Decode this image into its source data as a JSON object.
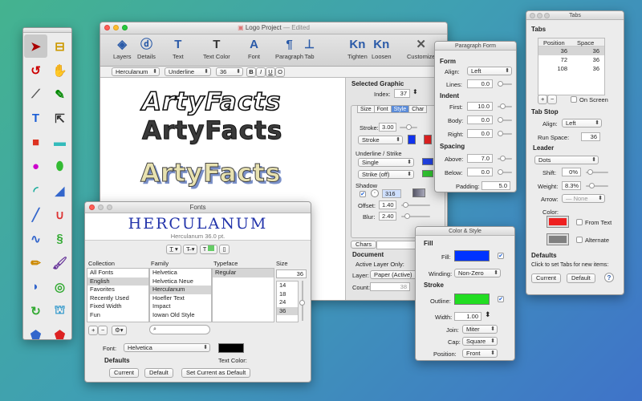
{
  "tools": [
    "select-arrow-icon",
    "measure-tape-icon",
    "rotate-icon",
    "hand-icon",
    "scalpel-icon",
    "reshape-icon",
    "text-tool-icon",
    "text-on-path-icon",
    "rectangle-icon",
    "rounded-rect-icon",
    "circle-icon",
    "oval-icon",
    "arc-icon",
    "polygon-icon",
    "line-icon",
    "curve-icon",
    "bezier-icon",
    "spiral-icon",
    "pencil-icon",
    "brush-icon",
    "freeform-icon",
    "swirl-icon",
    "rotate-arrow-icon",
    "paint-bucket-icon",
    "pentagon-icon",
    "pentagon-red-icon"
  ],
  "main": {
    "title": "Logo Project",
    "edited": "— Edited",
    "toolbar": [
      {
        "label": "Layers",
        "icon": "layers-icon",
        "glyph": "◈",
        "color": "#2a5aa8"
      },
      {
        "label": "Details",
        "icon": "details-icon",
        "glyph": "ⓓ",
        "color": "#2a5aa8"
      },
      {
        "label": "Text",
        "icon": "text-icon",
        "glyph": "T",
        "color": "#2a5aa8"
      },
      {
        "label": "Text Color",
        "icon": "text-color-icon",
        "glyph": "T",
        "color": "#333"
      },
      {
        "label": "Font",
        "icon": "font-icon",
        "glyph": "A",
        "color": "#2a5aa8"
      },
      {
        "label": "Paragraph",
        "icon": "paragraph-icon",
        "glyph": "¶",
        "color": "#2a5aa8"
      },
      {
        "label": "Tab",
        "icon": "tab-icon",
        "glyph": "⊥",
        "color": "#2a5aa8"
      },
      {
        "label": "Tighten",
        "icon": "tighten-icon",
        "glyph": "Kn",
        "color": "#2a5aa8"
      },
      {
        "label": "Loosen",
        "icon": "loosen-icon",
        "glyph": "Kn",
        "color": "#2a5aa8"
      },
      {
        "label": "Customize",
        "icon": "customize-icon",
        "glyph": "✕",
        "color": "#555"
      }
    ],
    "fmt": {
      "font": "Herculanum",
      "underline": "Underline",
      "size": "36",
      "b": "B",
      "i": "I",
      "u": "U",
      "o": "O"
    },
    "art": "ArtyFacts"
  },
  "inspector": {
    "heading": "Selected Graphic",
    "index_label": "Index:",
    "index": "37",
    "tabs": [
      "Size",
      "Font",
      "Style",
      "Char"
    ],
    "stroke_label": "Stroke:",
    "stroke": "3.00",
    "stroke_pop": "Stroke",
    "underline_head": "Underline / Strike",
    "single": "Single",
    "strike": "Strike (off)",
    "shadow": "Shadow",
    "shadow_val": "316",
    "offset_label": "Offset:",
    "offset": "1.40",
    "blur_label": "Blur:",
    "blur": "2.40",
    "chars": "Chars",
    "doc_head": "Document",
    "active_layer": "Active Layer Only:",
    "layer_label": "Layer:",
    "layer": "Paper (Active)",
    "count_label": "Count:",
    "count": "38"
  },
  "para": {
    "title": "Paragraph Form",
    "form": "Form",
    "align_label": "Align:",
    "align": "Left",
    "lines_label": "Lines:",
    "lines": "0.0",
    "indent": "Indent",
    "first_label": "First:",
    "first": "10.0",
    "body_label": "Body:",
    "body": "0.0",
    "right_label": "Right:",
    "right": "0.0",
    "spacing": "Spacing",
    "above_label": "Above:",
    "above": "7.0",
    "below_label": "Below:",
    "below": "0.0",
    "padding_label": "Padding:",
    "padding": "5.0"
  },
  "tabs": {
    "title": "Tabs",
    "heading": "Tabs",
    "col_pos": "Position",
    "col_space": "Space",
    "rows": [
      [
        "36",
        "36"
      ],
      [
        "72",
        "36"
      ],
      [
        "108",
        "36"
      ]
    ],
    "on_screen": "On Screen",
    "tabstop": "Tab Stop",
    "align_label": "Align:",
    "align": "Left",
    "run_label": "Run Space:",
    "run": "36",
    "leader": "Leader",
    "dots": "Dots",
    "shift_label": "Shift:",
    "shift": "0%",
    "weight_label": "Weight:",
    "weight": "8.3%",
    "arrow_label": "Arrow:",
    "arrow": "— None",
    "color_label": "Color:",
    "from_text": "From Text",
    "alternate": "Alternate",
    "defaults": "Defaults",
    "click_text": "Click to set Tabs for new items:",
    "current": "Current",
    "default": "Default",
    "help": "?"
  },
  "fonts": {
    "title": "Fonts",
    "preview": "HERCULANUM",
    "preview_sub": "Herculanum 36.0 pt.",
    "col_collection": "Collection",
    "col_family": "Family",
    "col_typeface": "Typeface",
    "col_size": "Size",
    "collections": [
      "All Fonts",
      "English",
      "Favorites",
      "Recently Used",
      "Fixed Width",
      "Fun"
    ],
    "families": [
      "Helvetica",
      "Helvetica Neue",
      "Herculanum",
      "Hoefler Text",
      "Impact",
      "Iowan Old Style"
    ],
    "typefaces": [
      "Regular"
    ],
    "size": "36",
    "sizes": [
      "14",
      "18",
      "24",
      "36"
    ],
    "font_label": "Font:",
    "font": "Helvetica",
    "defaults": "Defaults",
    "text_color": "Text Color:",
    "current": "Current",
    "default": "Default",
    "set_current": "Set Current as Default"
  },
  "color": {
    "title": "Color & Style",
    "fill": "Fill",
    "fill_label": "Fill:",
    "fill_color": "#0033ff",
    "winding_label": "Winding:",
    "winding": "Non-Zero",
    "stroke": "Stroke",
    "outline_label": "Outline:",
    "outline_color": "#22dd22",
    "width_label": "Width:",
    "width": "1.00",
    "join_label": "Join:",
    "join": "Miter",
    "cap_label": "Cap:",
    "cap": "Square",
    "position_label": "Position:",
    "position": "Front"
  }
}
